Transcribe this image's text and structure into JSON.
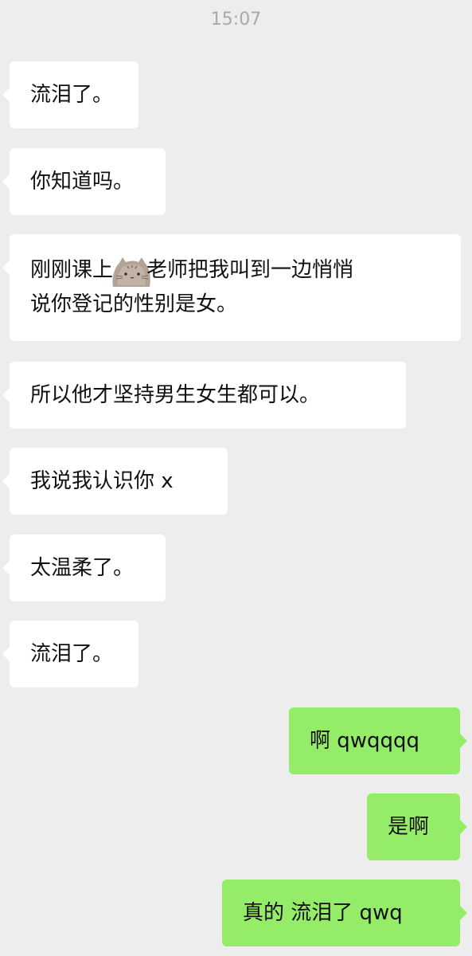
{
  "header": {
    "time": "15:07"
  },
  "messages": {
    "in": [
      "流泪了。",
      "你知道吗。",
      "刚刚课上",
      "老师把我叫到一边悄悄",
      "说你登记的性别是女。",
      "所以他才坚持男生女生都可以。",
      "我说我认识你 x",
      "太温柔了。",
      "流泪了。"
    ],
    "out": [
      "啊 qwqqqq",
      "是啊",
      "真的 流泪了 qwq"
    ]
  },
  "colors": {
    "background": "#ededed",
    "incoming_bubble": "#ffffff",
    "outgoing_bubble": "#95ec69",
    "timestamp_text": "#a9a9a9"
  },
  "icons": {
    "sticker": "pusheen-cat-sticker"
  }
}
